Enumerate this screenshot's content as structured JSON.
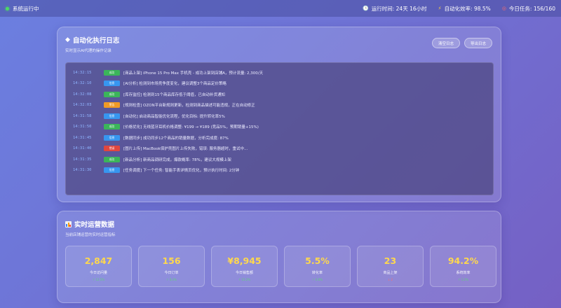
{
  "topbar": {
    "status": "系统运行中",
    "items": [
      {
        "icon": "clock-icon",
        "text": "运行时间: 24天 16小时"
      },
      {
        "icon": "bolt-icon",
        "text": "自动化效率: 98.5%"
      },
      {
        "icon": "target-icon",
        "text": "今日任务: 156/160"
      }
    ]
  },
  "log": {
    "title": "自动化执行日志",
    "subtitle": "实时显示AI代理的操作记录",
    "buttons": {
      "clear": "清空日志",
      "export": "导出日志"
    },
    "tag_colors": {
      "success": "#3bb55a",
      "info": "#3796f0",
      "warning": "#f09a26",
      "error": "#e0473f"
    },
    "entries": [
      {
        "time": "14:32:15",
        "tag": "成功",
        "type": "success",
        "text": "[商品上架] iPhone 15 Pro Max 手机壳 - 成功上架到店铺A，预计流量: 2,300/天"
      },
      {
        "time": "14:32:10",
        "tag": "信息",
        "type": "info",
        "text": "[AI分析] 检测到市场竞争度变化，建议调整3个商品定价策略"
      },
      {
        "time": "14:32:08",
        "tag": "成功",
        "type": "success",
        "text": "[库存监控] 检测到15个商品库存低于阈值，已自动补货通知"
      },
      {
        "time": "14:32:03",
        "tag": "警告",
        "type": "warning",
        "text": "[规则检查] OZON平台新规则更新，检测到商品描述可能违规，正在自动修正"
      },
      {
        "time": "14:31:58",
        "tag": "信息",
        "type": "info",
        "text": "[自动化] 启动商品智能优化流程，优化目标: 提升转化率5%"
      },
      {
        "time": "14:31:50",
        "tag": "成功",
        "type": "success",
        "text": "[价格优化] 无线蓝牙耳机价格调整: ¥199 → ¥189 (竞品5%，预期销量+15%)"
      },
      {
        "time": "14:31:45",
        "tag": "信息",
        "type": "info",
        "text": "[数据同步] 成功同步12个商品的销量数据，分析完成度: 87%"
      },
      {
        "time": "14:31:40",
        "tag": "错误",
        "type": "error",
        "text": "[图片上传] MacBook保护壳图片上传失败，错误: 服务器超时，重试中..."
      },
      {
        "time": "14:31:35",
        "tag": "成功",
        "type": "success",
        "text": "[新品分析] 新商品调研完成，爆款概率: 78%，建议大规模上架"
      },
      {
        "time": "14:31:30",
        "tag": "信息",
        "type": "info",
        "text": "[任务调度] 下一个任务: 智能手表详情页优化，预计执行时间: 2分钟"
      }
    ]
  },
  "metrics": {
    "title": "实时运营数据",
    "subtitle": "当前店铺运营的实时运营指标",
    "items": [
      {
        "value": "2,847",
        "label": "今日访问量",
        "change": "↑ 12.5%",
        "change_color": "#5fd47a"
      },
      {
        "value": "156",
        "label": "今日订单",
        "change": "↑ 8.3%",
        "change_color": "#5fd47a"
      },
      {
        "value": "¥8,945",
        "label": "今日销售额",
        "change": "↑ 15.2%",
        "change_color": "#5fd47a"
      },
      {
        "value": "5.5%",
        "label": "转化率",
        "change": "↑ 0.8%",
        "change_color": "#5fd47a"
      },
      {
        "value": "23",
        "label": "商品上架",
        "change": "↓ 2",
        "change_color": "#ff6b6b"
      },
      {
        "value": "94.2%",
        "label": "系统效率",
        "change": "↑ 1.2%",
        "change_color": "#5fd47a"
      }
    ]
  }
}
